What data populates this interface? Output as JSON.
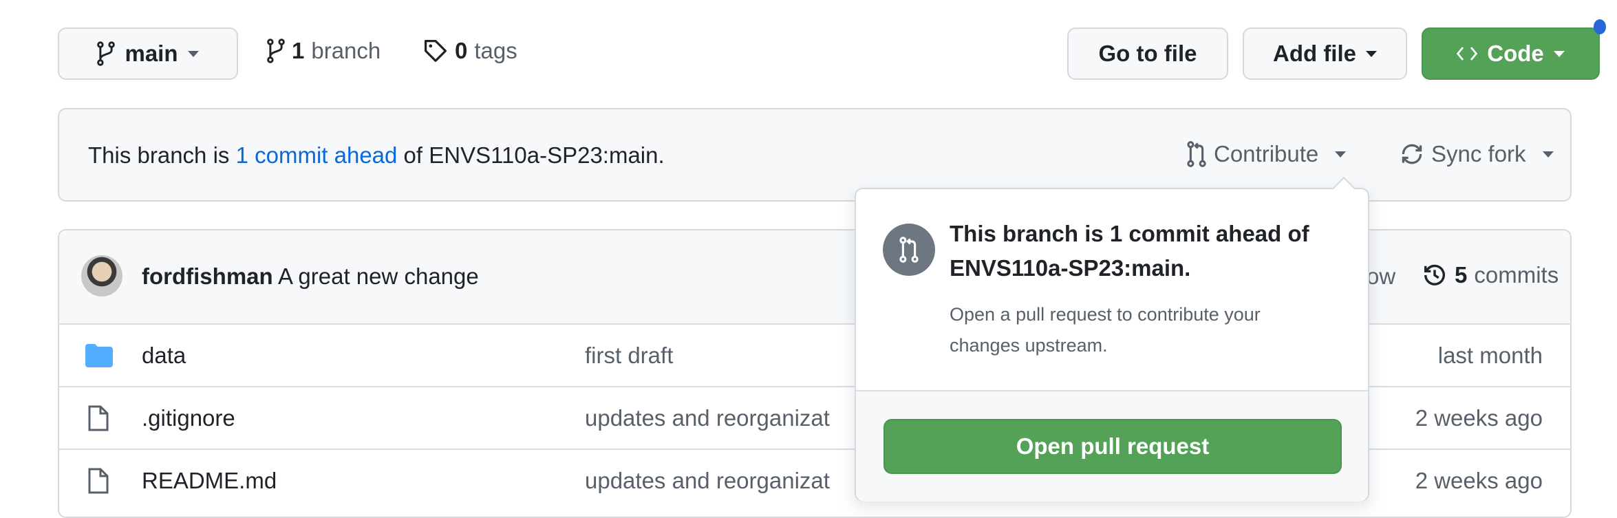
{
  "toolbar": {
    "branch_select": "main",
    "branch_count": "1",
    "branch_label": "branch",
    "tag_count": "0",
    "tag_label": "tags",
    "go_to_file": "Go to file",
    "add_file": "Add file",
    "code": "Code"
  },
  "banner": {
    "prefix": "This branch is ",
    "link": "1 commit ahead",
    "suffix": " of ENVS110a-SP23:main.",
    "contribute": "Contribute",
    "sync_fork": "Sync fork"
  },
  "commit": {
    "author": "fordfishman",
    "message": "A great new change",
    "time_partial": "ow",
    "count": "5",
    "count_label": "commits"
  },
  "files": [
    {
      "name": "data",
      "icon": "folder-icon",
      "message": "first draft",
      "time": "last month"
    },
    {
      "name": ".gitignore",
      "icon": "file-icon",
      "message": "updates and reorganizat",
      "time": "2 weeks ago"
    },
    {
      "name": "README.md",
      "icon": "file-icon",
      "message": "updates and reorganizat",
      "time": "2 weeks ago"
    }
  ],
  "popover": {
    "title": "This branch is 1 commit ahead of ENVS110a-SP23:main.",
    "body": "Open a pull request to contribute your changes upstream.",
    "button": "Open pull request"
  },
  "colors": {
    "accent_green": "#53a258",
    "link_blue": "#0969da",
    "notification_dot": "#2767d8"
  }
}
